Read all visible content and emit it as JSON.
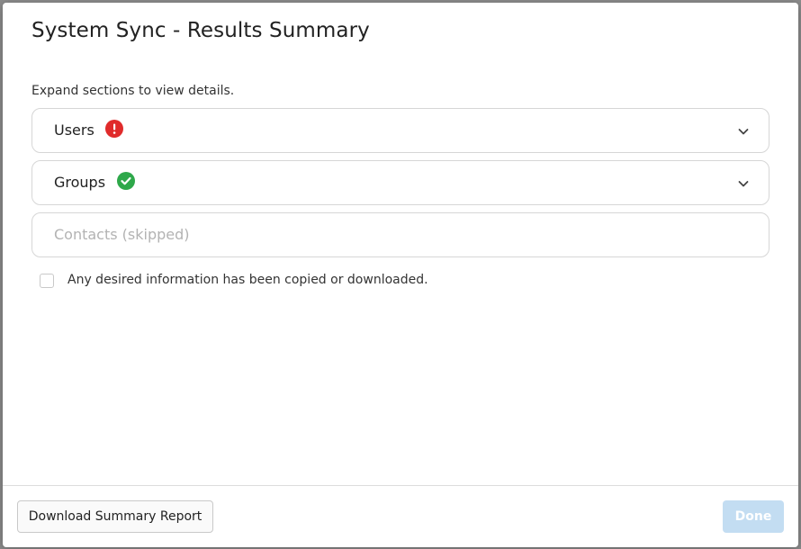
{
  "dialog": {
    "title": "System Sync - Results Summary",
    "instructions": "Expand sections to view details."
  },
  "sections": [
    {
      "label": "Users",
      "status": "error",
      "status_icon": "exclamation-circle-icon",
      "status_color": "#e02b2b",
      "expandable": true
    },
    {
      "label": "Groups",
      "status": "success",
      "status_icon": "check-circle-icon",
      "status_color": "#2ea84a",
      "expandable": true
    },
    {
      "label": "Contacts (skipped)",
      "status": "skipped",
      "expandable": false
    }
  ],
  "confirmation": {
    "label": "Any desired information has been copied or downloaded.",
    "checked": false
  },
  "footer": {
    "download_label": "Download Summary Report",
    "done_label": "Done",
    "done_enabled": false,
    "done_color": "#c3ddf2"
  }
}
